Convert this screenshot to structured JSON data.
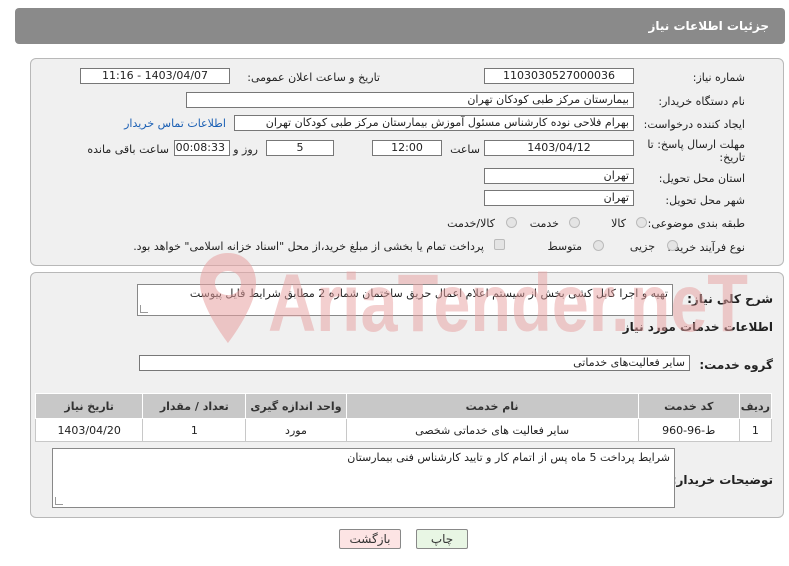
{
  "header": {
    "title": "جزئیات اطلاعات نیاز"
  },
  "form": {
    "need_number_label": "شماره نیاز:",
    "need_number": "1103030527000036",
    "announce_label": "تاریخ و ساعت اعلان عمومی:",
    "announce_value": "1403/04/07 - 11:16",
    "buyer_label": "نام دستگاه خریدار:",
    "buyer_value": "بیمارستان مرکز طبی کودکان تهران",
    "creator_label": "ایجاد کننده درخواست:",
    "creator_value": "بهرام فلاحی نوده کارشناس مسئول آموزش بیمارستان مرکز طبی کودکان تهران",
    "contact_link": "اطلاعات تماس خریدار",
    "deadline_label": "مهلت ارسال پاسخ: تا تاریخ:",
    "deadline_date": "1403/04/12",
    "time_label": "ساعت",
    "deadline_time": "12:00",
    "days_value": "5",
    "days_label": "روز و",
    "remaining_value": "00:08:33",
    "remaining_label": "ساعت باقی مانده",
    "province_label": "استان محل تحویل:",
    "province_value": "تهران",
    "city_label": "شهر محل تحویل:",
    "city_value": "تهران",
    "category_label": "طبقه بندی موضوعی:",
    "category_options": [
      "کالا",
      "خدمت",
      "کالا/خدمت"
    ],
    "process_label": "نوع فرآیند خرید :",
    "process_options": [
      "جزیی",
      "متوسط"
    ],
    "payment_note": "پرداخت تمام یا بخشی از مبلغ خرید،از محل \"اسناد خزانه اسلامی\" خواهد بود."
  },
  "details": {
    "summary_label": "شرح کلی نیاز:",
    "summary_value": "تهیه و اجرا کابل کشی بخش از سیستم اعلام اعمال حریق ساختمان شماره 2 مطابق شرایط فایل پیوست",
    "services_heading": "اطلاعات خدمات مورد نیاز",
    "service_group_label": "گروه خدمت:",
    "service_group_value": "سایر فعالیت‌های خدماتی",
    "table": {
      "headers": [
        "ردیف",
        "کد خدمت",
        "نام خدمت",
        "واحد اندازه گیری",
        "تعداد / مقدار",
        "تاریخ نیاز"
      ],
      "rows": [
        [
          "1",
          "ط-96-960",
          "سایر فعالیت های خدماتی شخصی",
          "مورد",
          "1",
          "1403/04/20"
        ]
      ]
    },
    "buyer_notes_label": "توضیحات خریدار:",
    "buyer_notes_value": "شرایط پرداخت 5 ماه پس از اتمام کار و تایید کارشناس فنی بیمارستان"
  },
  "buttons": {
    "print": "چاپ",
    "back": "بازگشت"
  },
  "watermark": {
    "text": "AriaTender.neT"
  },
  "colors": {
    "header_bg": "#8a8a8a",
    "panel_bg": "#f0f0f0",
    "watermark": "#e89a9a",
    "link": "#1a5fb4"
  }
}
